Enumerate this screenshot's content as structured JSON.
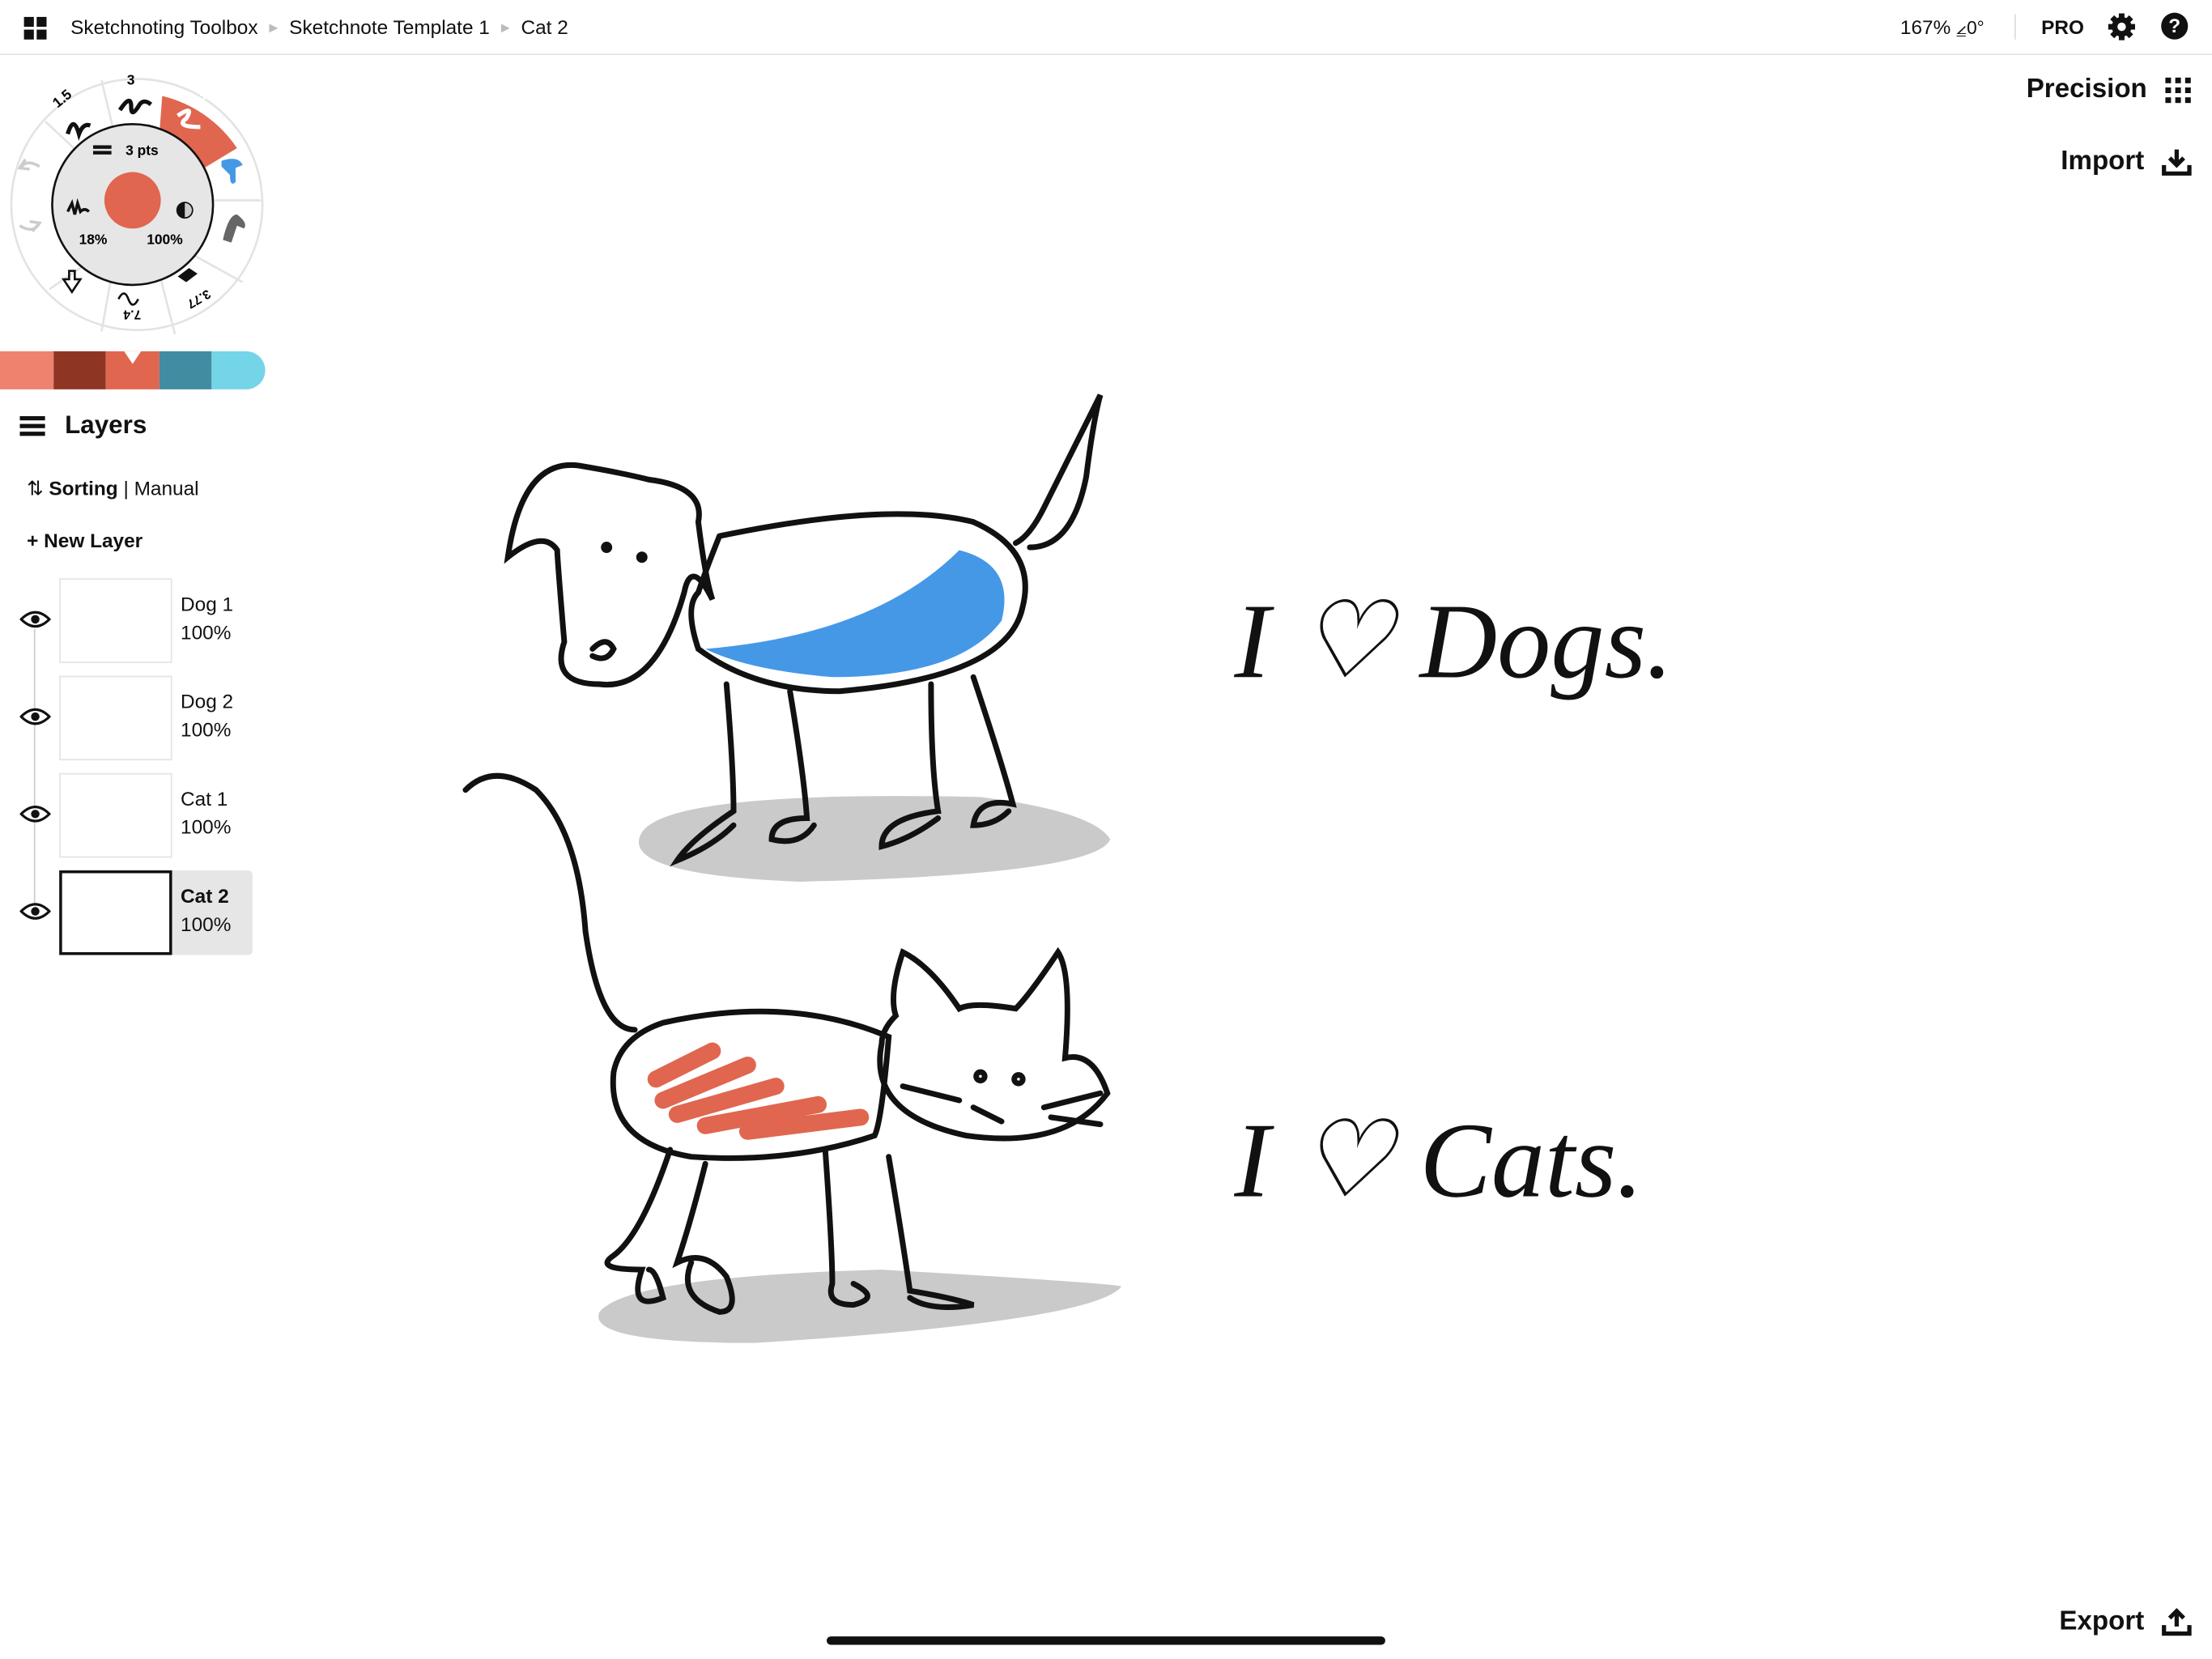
{
  "topbar": {
    "breadcrumbs": [
      "Sketchnoting Toolbox",
      "Sketchnote Template 1",
      "Cat 2"
    ],
    "zoom": "167%",
    "rotation": "⦤0°",
    "pro_label": "PRO",
    "icons": [
      "grid-icon",
      "gear-icon",
      "help-icon"
    ]
  },
  "right_panel": {
    "precision_label": "Precision",
    "import_label": "Import",
    "export_label": "Export"
  },
  "tool_wheel": {
    "brush_sizes": [
      "1.5",
      "3",
      "3"
    ],
    "size_readout": "3 pts",
    "smoothing": "18%",
    "opacity": "100%",
    "bottom_values": [
      "7.4",
      "3.77"
    ],
    "current_color": "#E06650"
  },
  "palette": {
    "colors": [
      "#EE826E",
      "#8F3524",
      "#E06650",
      "#418CA0",
      "#74D4E8"
    ],
    "selected_index": 2
  },
  "layers": {
    "title": "Layers",
    "sorting_label": "Sorting",
    "sorting_value": "Manual",
    "new_layer_label": "New Layer",
    "items": [
      {
        "name": "Dog 1",
        "opacity": "100%",
        "visible": true
      },
      {
        "name": "Dog 2",
        "opacity": "100%",
        "visible": true
      },
      {
        "name": "Cat 1",
        "opacity": "100%",
        "visible": true
      },
      {
        "name": "Cat 2",
        "opacity": "100%",
        "visible": true,
        "selected": true
      }
    ]
  },
  "canvas": {
    "dog_caption": "I ♡ Dogs.",
    "cat_caption": "I ♡ Cats.",
    "colors": {
      "dog_coat": "#4598E6",
      "cat_stripes": "#E06650",
      "shadow": "#CACACA"
    }
  }
}
